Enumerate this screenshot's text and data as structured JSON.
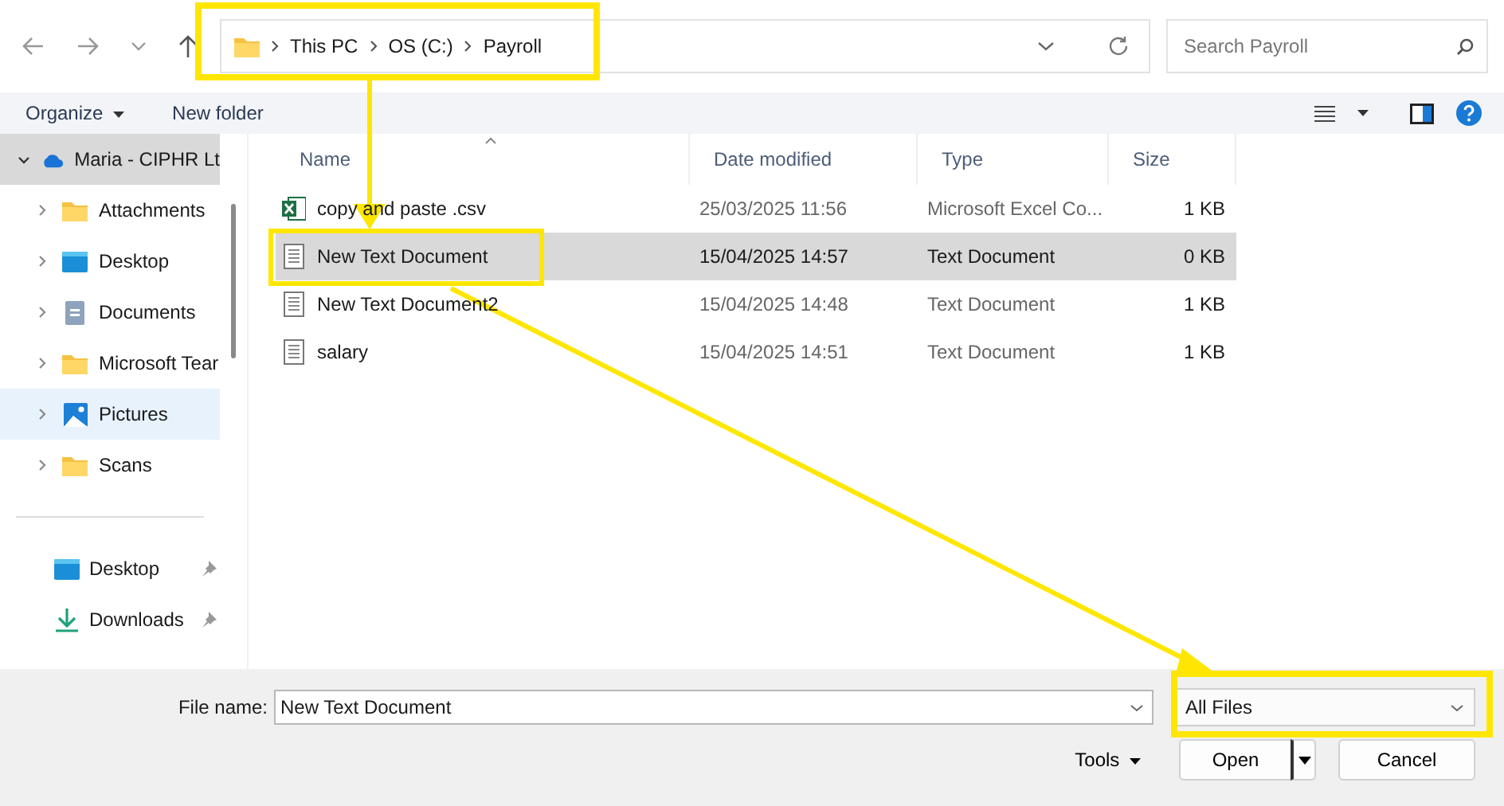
{
  "breadcrumb": [
    "This PC",
    "OS (C:)",
    "Payroll"
  ],
  "search": {
    "placeholder": "Search Payroll"
  },
  "toolbar": {
    "organize": "Organize",
    "new_folder": "New folder"
  },
  "sidebar": {
    "root": {
      "label": "Maria - CIPHR Lt",
      "expanded": true,
      "selected": true,
      "children": [
        {
          "label": "Attachments",
          "kind": "folder",
          "selected": false
        },
        {
          "label": "Desktop",
          "kind": "desktop",
          "selected": false
        },
        {
          "label": "Documents",
          "kind": "documents",
          "selected": false
        },
        {
          "label": "Microsoft Tear",
          "kind": "folder",
          "selected": false
        },
        {
          "label": "Pictures",
          "kind": "pictures",
          "selected": true
        },
        {
          "label": "Scans",
          "kind": "folder",
          "selected": false
        }
      ]
    },
    "quick_access": [
      {
        "label": "Desktop",
        "kind": "desktop"
      },
      {
        "label": "Downloads",
        "kind": "downloads"
      }
    ]
  },
  "table": {
    "columns": [
      "Name",
      "Date modified",
      "Type",
      "Size"
    ],
    "rows": [
      {
        "name": "copy and paste .csv",
        "kind": "excel",
        "date": "25/03/2025 11:56",
        "type": "Microsoft Excel Co...",
        "size": "1 KB",
        "selected": false
      },
      {
        "name": "New Text Document",
        "kind": "text",
        "date": "15/04/2025 14:57",
        "type": "Text Document",
        "size": "0 KB",
        "selected": true
      },
      {
        "name": "New Text Document2",
        "kind": "text",
        "date": "15/04/2025 14:48",
        "type": "Text Document",
        "size": "1 KB",
        "selected": false
      },
      {
        "name": "salary",
        "kind": "text",
        "date": "15/04/2025 14:51",
        "type": "Text Document",
        "size": "1 KB",
        "selected": false
      }
    ]
  },
  "footer": {
    "file_name_label": "File name:",
    "file_name": "New Text Document",
    "file_type": "All Files",
    "tools": "Tools",
    "open": "Open",
    "cancel": "Cancel"
  }
}
